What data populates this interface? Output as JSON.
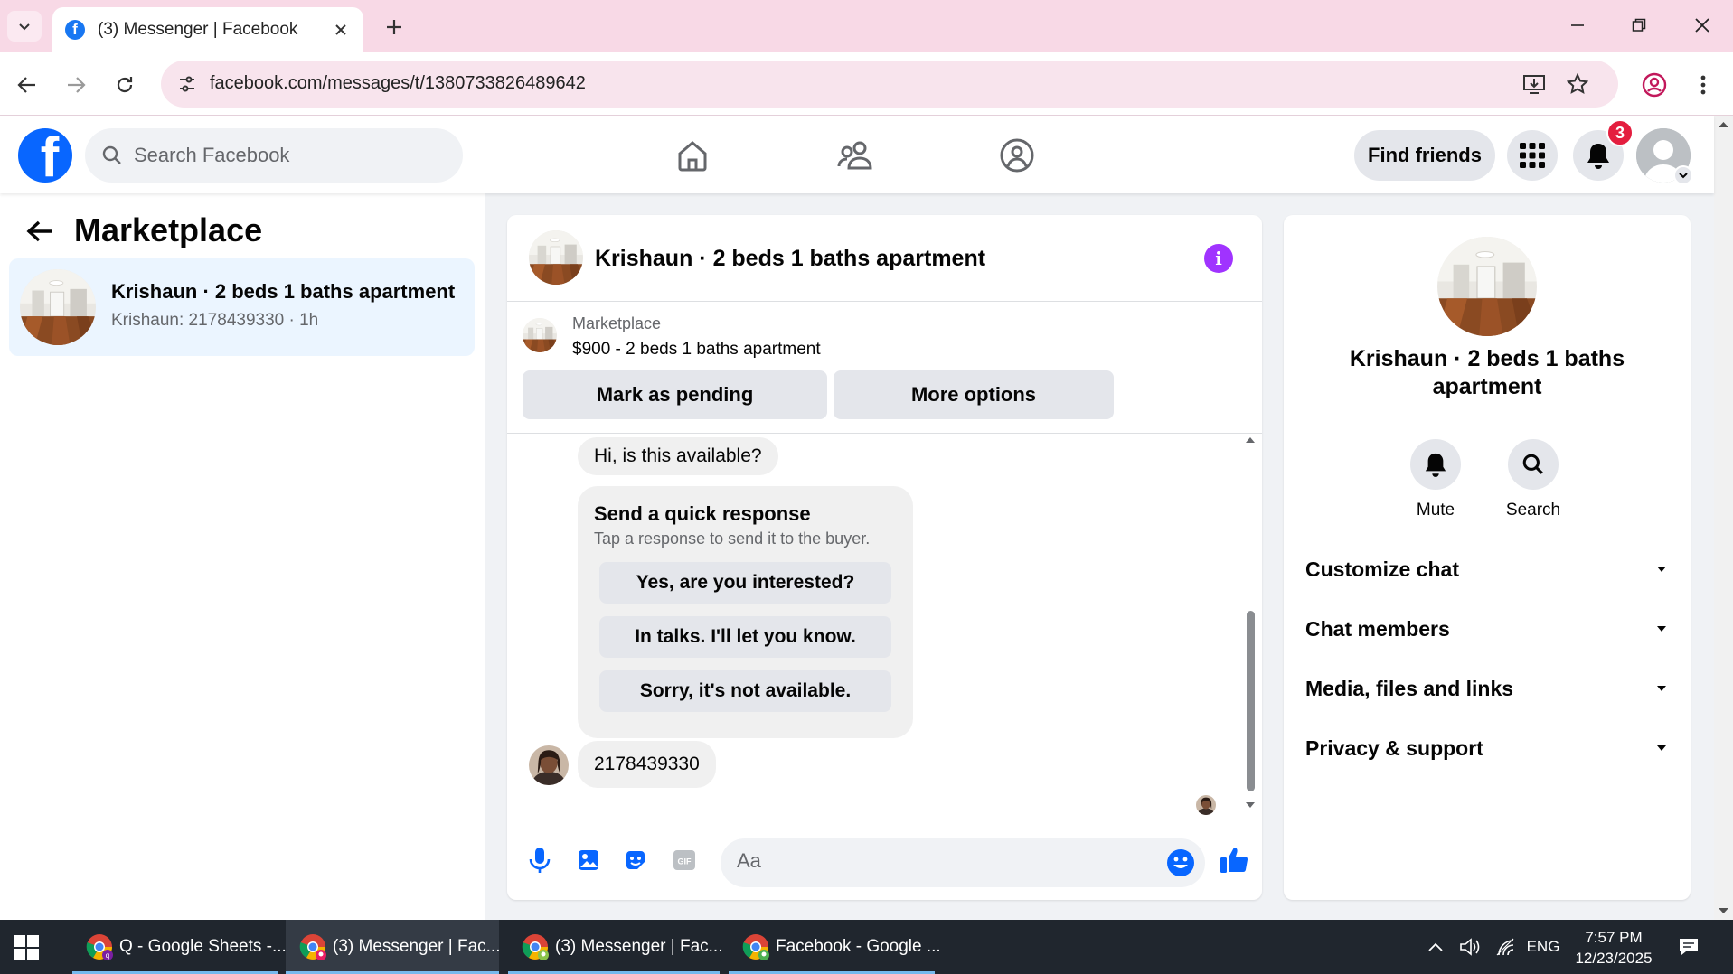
{
  "browser": {
    "tab_title": "(3) Messenger | Facebook",
    "url": "facebook.com/messages/t/1380733826489642"
  },
  "fb": {
    "search_placeholder": "Search Facebook",
    "find_friends": "Find friends",
    "notification_count": "3"
  },
  "sidebar": {
    "title": "Marketplace",
    "conversations": [
      {
        "name": "Krishaun · 2 beds 1 baths apartment",
        "snippet": "Krishaun: 2178439330 · 1h"
      }
    ]
  },
  "chat": {
    "title": "Krishaun · 2 beds 1 baths apartment",
    "listing_label": "Marketplace",
    "listing_desc": "$900 - 2 beds 1 baths apartment",
    "mark_pending": "Mark as pending",
    "more_options": "More options",
    "messages": {
      "first": "Hi, is this available?",
      "quick_title": "Send a quick response",
      "quick_sub": "Tap a response to send it to the buyer.",
      "quick_responses": [
        "Yes, are you interested?",
        "In talks. I'll let you know.",
        "Sorry, it's not available."
      ],
      "reply": "2178439330"
    },
    "composer_placeholder": "Aa"
  },
  "info_panel": {
    "name": "Krishaun · 2 beds 1 baths apartment",
    "actions": [
      {
        "label": "Mute",
        "icon": "bell-icon"
      },
      {
        "label": "Search",
        "icon": "search-icon"
      }
    ],
    "sections": [
      "Customize chat",
      "Chat members",
      "Media, files and links",
      "Privacy & support"
    ]
  },
  "taskbar": {
    "items": [
      {
        "label": "Q - Google Sheets -..."
      },
      {
        "label": "(3) Messenger | Fac..."
      },
      {
        "label": "(3) Messenger | Fac..."
      },
      {
        "label": "Facebook - Google ..."
      }
    ],
    "lang": "ENG",
    "time": "7:57 PM",
    "date": "12/23/2025"
  },
  "colors": {
    "fb_blue": "#0866ff",
    "accent_purple": "#a033ff",
    "selected_conv": "#ebf5ff",
    "tabstrip_pink": "#f8d9e6"
  }
}
